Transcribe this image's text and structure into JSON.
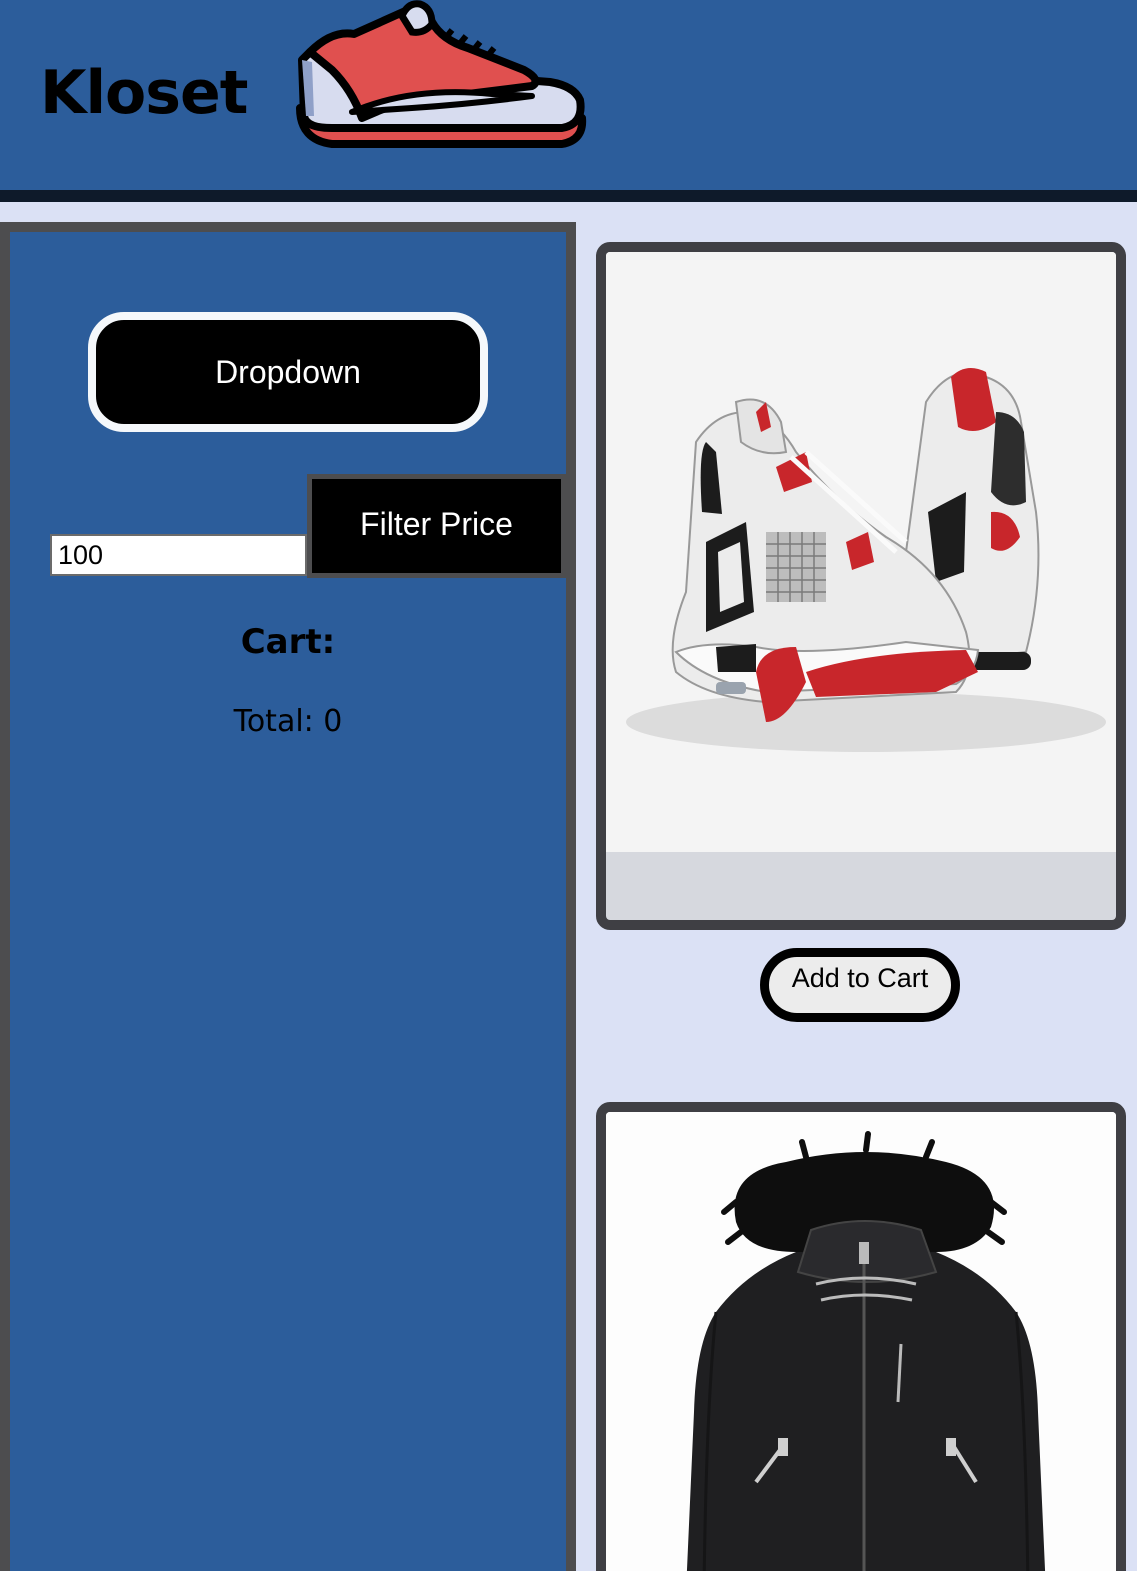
{
  "header": {
    "brand": "Kloset",
    "logo_icon": "sneaker-icon"
  },
  "sidebar": {
    "dropdown_label": "Dropdown",
    "price_value": "100",
    "filter_label": "Filter Price",
    "cart_title": "Cart:",
    "cart_total": "Total: 0"
  },
  "products": [
    {
      "image": "sneaker-pair-image",
      "button_label": "Add to Cart"
    },
    {
      "image": "jacket-image"
    }
  ],
  "colors": {
    "header_bg": "#2c5d9b",
    "sidebar_bg": "#2c5d9b",
    "page_bg": "#dbe1f5",
    "button_dark": "#000000"
  }
}
